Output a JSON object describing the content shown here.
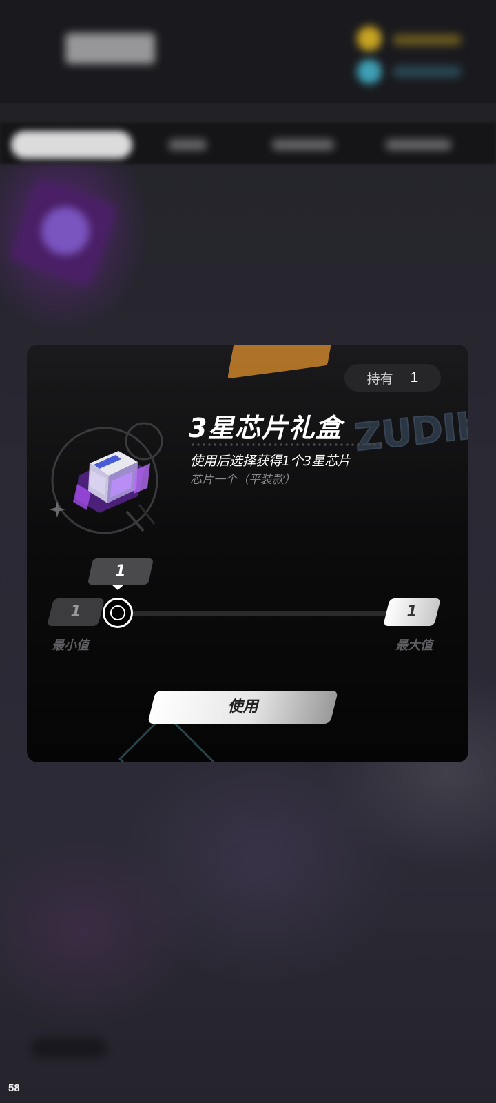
{
  "status": {
    "fps": "58"
  },
  "dialog": {
    "owned_label": "持有",
    "owned_count": "1",
    "item_name": "3星芯片礼盒",
    "item_desc": "使用后选择获得1个3星芯片",
    "item_subdesc": "芯片一个（平装款）",
    "graffiti_text": "ZUDIK"
  },
  "quantity": {
    "current": "1",
    "min_value": "1",
    "max_value": "1",
    "min_label": "最小值",
    "max_label": "最大值",
    "slider_fraction": 0
  },
  "actions": {
    "use_label": "使用"
  },
  "icons": {
    "item": "purple-chip-gift-box-icon",
    "sparkle": "sparkle-icon"
  }
}
